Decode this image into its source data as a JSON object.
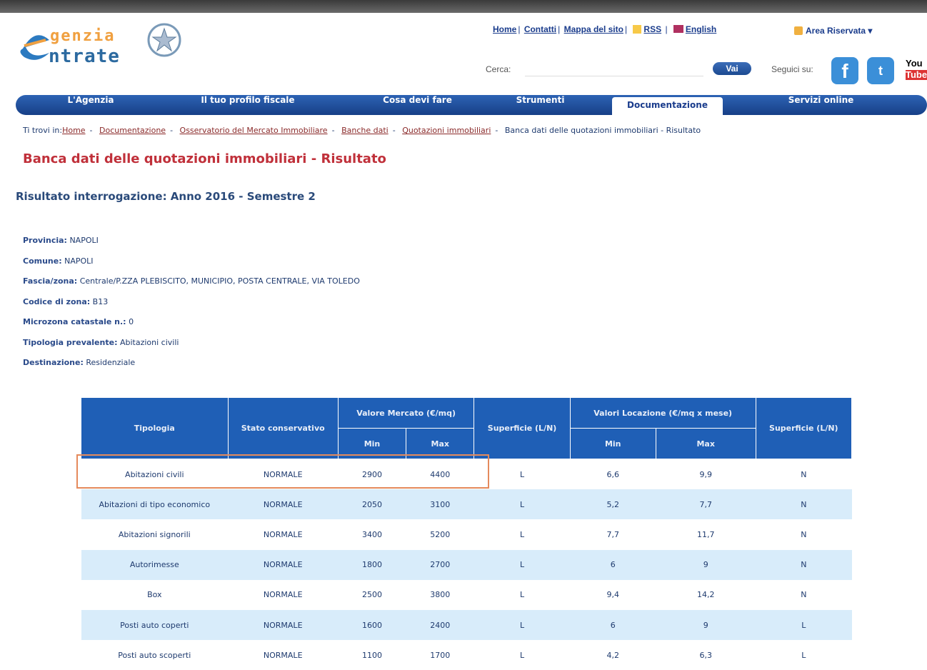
{
  "header": {
    "logo_line1": "genzia",
    "logo_line2": "ntrate",
    "links": [
      "Home",
      "Contatti",
      "Mappa del sito",
      "RSS",
      "English"
    ],
    "area_riservata": "Area Riservata",
    "search_label": "Cerca:",
    "search_value": "",
    "search_button": "Vai",
    "follow_label": "Seguici su:",
    "social": {
      "facebook": "f",
      "twitter": "t",
      "youtube_line1": "You",
      "youtube_line2": "Tube"
    }
  },
  "nav": {
    "tabs": [
      "L'Agenzia",
      "Il tuo profilo fiscale",
      "Cosa devi fare",
      "Strumenti",
      "Documentazione",
      "Servizi online"
    ],
    "active": "Documentazione"
  },
  "breadcrumb": {
    "prefix": "Ti trovi in:",
    "links": [
      "Home",
      "Documentazione",
      "Osservatorio del Mercato Immobiliare",
      "Banche dati",
      "Quotazioni immobiliari"
    ],
    "current": "Banca dati delle quotazioni immobiliari - Risultato"
  },
  "page_title": "Banca dati delle quotazioni immobiliari - Risultato",
  "subtitle": "Risultato interrogazione: Anno 2016 - Semestre 2",
  "info": [
    {
      "label": "Provincia:",
      "value": "NAPOLI"
    },
    {
      "label": "Comune:",
      "value": "NAPOLI"
    },
    {
      "label": "Fascia/zona:",
      "value": "Centrale/P.ZZA PLEBISCITO, MUNICIPIO, POSTA CENTRALE, VIA TOLEDO"
    },
    {
      "label": "Codice di zona:",
      "value": "B13"
    },
    {
      "label": "Microzona catastale n.:",
      "value": "0"
    },
    {
      "label": "Tipologia prevalente:",
      "value": "Abitazioni civili"
    },
    {
      "label": "Destinazione:",
      "value": "Residenziale"
    }
  ],
  "table": {
    "headers": {
      "tipologia": "Tipologia",
      "stato": "Stato conservativo",
      "valore_mercato": "Valore Mercato (€/mq)",
      "superficie1": "Superficie (L/N)",
      "valori_locazione": "Valori Locazione (€/mq x mese)",
      "superficie2": "Superficie (L/N)",
      "min": "Min",
      "max": "Max"
    },
    "rows": [
      {
        "tipologia": "Abitazioni civili",
        "stato": "NORMALE",
        "vm_min": "2900",
        "vm_max": "4400",
        "sup1": "L",
        "vl_min": "6,6",
        "vl_max": "9,9",
        "sup2": "N"
      },
      {
        "tipologia": "Abitazioni di tipo economico",
        "stato": "NORMALE",
        "vm_min": "2050",
        "vm_max": "3100",
        "sup1": "L",
        "vl_min": "5,2",
        "vl_max": "7,7",
        "sup2": "N"
      },
      {
        "tipologia": "Abitazioni signorili",
        "stato": "NORMALE",
        "vm_min": "3400",
        "vm_max": "5200",
        "sup1": "L",
        "vl_min": "7,7",
        "vl_max": "11,7",
        "sup2": "N"
      },
      {
        "tipologia": "Autorimesse",
        "stato": "NORMALE",
        "vm_min": "1800",
        "vm_max": "2700",
        "sup1": "L",
        "vl_min": "6",
        "vl_max": "9",
        "sup2": "N"
      },
      {
        "tipologia": "Box",
        "stato": "NORMALE",
        "vm_min": "2500",
        "vm_max": "3800",
        "sup1": "L",
        "vl_min": "9,4",
        "vl_max": "14,2",
        "sup2": "N"
      },
      {
        "tipologia": "Posti auto coperti",
        "stato": "NORMALE",
        "vm_min": "1600",
        "vm_max": "2400",
        "sup1": "L",
        "vl_min": "6",
        "vl_max": "9",
        "sup2": "L"
      },
      {
        "tipologia": "Posti auto scoperti",
        "stato": "NORMALE",
        "vm_min": "1100",
        "vm_max": "1700",
        "sup1": "L",
        "vl_min": "4,2",
        "vl_max": "6,3",
        "sup2": "L"
      }
    ]
  },
  "colors": {
    "nav": "#1f5fb6",
    "title": "#c0303a",
    "highlight": "#e58a5c",
    "row_alt": "#d8ecfa"
  }
}
